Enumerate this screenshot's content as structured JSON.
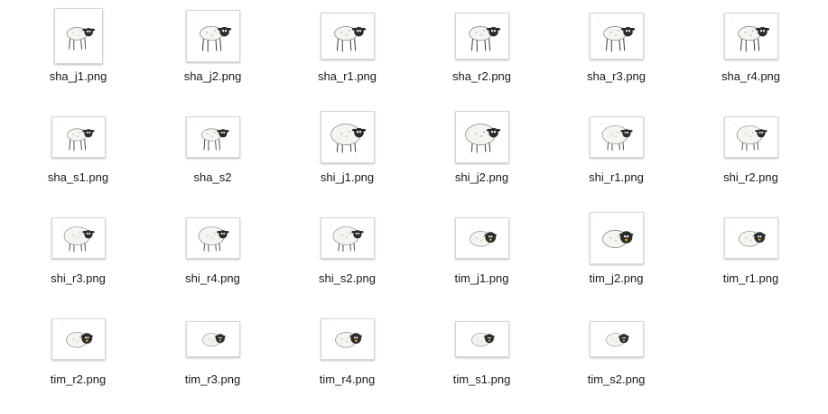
{
  "files": [
    {
      "name": "sha_j1.png",
      "kind": "tall",
      "char": "sha"
    },
    {
      "name": "sha_j2.png",
      "kind": "big",
      "char": "sha"
    },
    {
      "name": "sha_r1.png",
      "kind": "square",
      "char": "sha"
    },
    {
      "name": "sha_r2.png",
      "kind": "square",
      "char": "sha"
    },
    {
      "name": "sha_r3.png",
      "kind": "square",
      "char": "sha"
    },
    {
      "name": "sha_r4.png",
      "kind": "square",
      "char": "sha"
    },
    {
      "name": "sha_s1.png",
      "kind": "wide",
      "char": "sha"
    },
    {
      "name": "sha_s2",
      "kind": "wide",
      "char": "sha"
    },
    {
      "name": "shi_j1.png",
      "kind": "big",
      "char": "shi"
    },
    {
      "name": "shi_j2.png",
      "kind": "big",
      "char": "shi"
    },
    {
      "name": "shi_r1.png",
      "kind": "wide",
      "char": "shi"
    },
    {
      "name": "shi_r2.png",
      "kind": "wide",
      "char": "shi"
    },
    {
      "name": "shi_r3.png",
      "kind": "wide",
      "char": "shi"
    },
    {
      "name": "shi_r4.png",
      "kind": "wide",
      "char": "shi"
    },
    {
      "name": "shi_s2.png",
      "kind": "wide",
      "char": "shi"
    },
    {
      "name": "tim_j1.png",
      "kind": "wide",
      "char": "tim"
    },
    {
      "name": "tim_j2.png",
      "kind": "big",
      "char": "tim"
    },
    {
      "name": "tim_r1.png",
      "kind": "wide",
      "char": "tim"
    },
    {
      "name": "tim_r2.png",
      "kind": "wide",
      "char": "tim"
    },
    {
      "name": "tim_r3.png",
      "kind": "short",
      "char": "tim"
    },
    {
      "name": "tim_r4.png",
      "kind": "wide",
      "char": "tim"
    },
    {
      "name": "tim_s1.png",
      "kind": "short",
      "char": "tim"
    },
    {
      "name": "tim_s2.png",
      "kind": "short",
      "char": "tim"
    }
  ],
  "icon": "sheep-drawing-thumbnail-icon"
}
